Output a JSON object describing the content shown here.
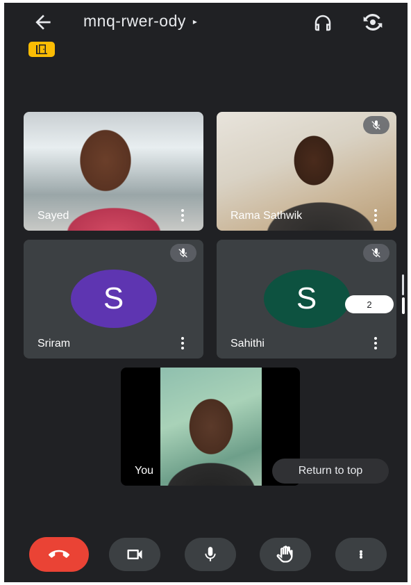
{
  "meeting": {
    "code": "mnq-rwer-ody",
    "caret": "▸"
  },
  "colors": {
    "background": "#202124",
    "tile": "#3c4043",
    "end_call": "#ea4335",
    "badge": "#fbbc04",
    "sriram_avatar": "#5e35b1",
    "sahithi_avatar": "#0d5240"
  },
  "icons": {
    "back": "arrow-left-icon",
    "title_caret": "caret-right-icon",
    "audio": "headset-icon",
    "switch_camera": "flip-camera-icon",
    "badge": "door-icon",
    "mute": "mic-off-icon",
    "more": "more-vert-icon",
    "end": "call-end-icon",
    "camera": "videocam-icon",
    "mic": "mic-icon",
    "hand": "raise-hand-icon"
  },
  "participants": [
    {
      "name": "Sayed",
      "muted": false,
      "video": true
    },
    {
      "name": "Rama Sathwik",
      "muted": true,
      "video": true
    },
    {
      "name": "Sriram",
      "muted": true,
      "video": false,
      "initial": "S"
    },
    {
      "name": "Sahithi",
      "muted": true,
      "video": false,
      "initial": "S"
    }
  ],
  "self_view": {
    "label": "You"
  },
  "return_to_top": "Return to top",
  "page_indicator": "2"
}
